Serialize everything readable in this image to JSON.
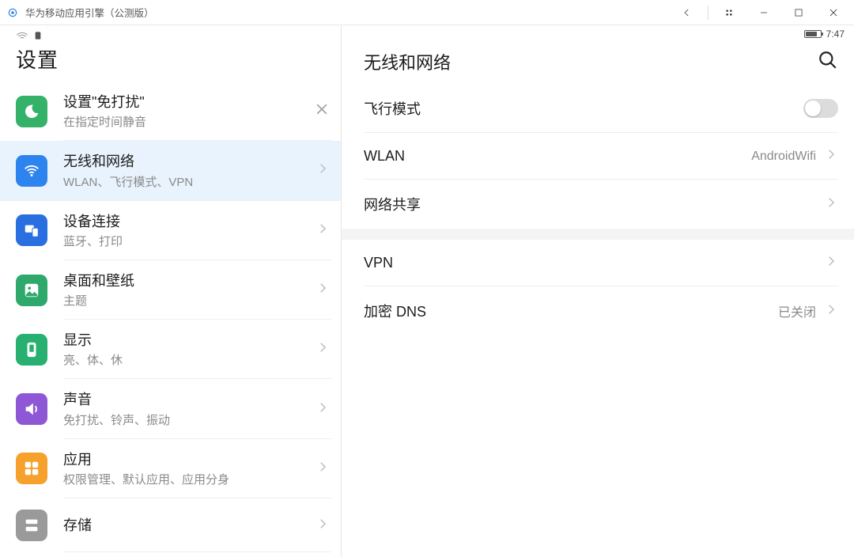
{
  "window": {
    "title": "华为移动应用引擎（公测版）"
  },
  "status": {
    "time": "7:47"
  },
  "left": {
    "title": "设置",
    "items": [
      {
        "icon": "moon",
        "bg": "bg-green",
        "label": "设置\"免打扰\"",
        "sub": "在指定时间静音",
        "trailing": "close"
      },
      {
        "icon": "wifi",
        "bg": "bg-blue",
        "label": "无线和网络",
        "sub": "WLAN、飞行模式、VPN",
        "trailing": "chev",
        "selected": true
      },
      {
        "icon": "devices",
        "bg": "bg-blue2",
        "label": "设备连接",
        "sub": "蓝牙、打印",
        "trailing": "chev"
      },
      {
        "icon": "wallpaper",
        "bg": "bg-green2",
        "label": "桌面和壁纸",
        "sub": "主题",
        "trailing": "chev"
      },
      {
        "icon": "display",
        "bg": "bg-teal",
        "label": "显示",
        "sub": "亮、体、休",
        "trailing": "chev"
      },
      {
        "icon": "sound",
        "bg": "bg-purple",
        "label": "声音",
        "sub": "免打扰、铃声、振动",
        "trailing": "chev"
      },
      {
        "icon": "apps",
        "bg": "bg-orange",
        "label": "应用",
        "sub": "权限管理、默认应用、应用分身",
        "trailing": "chev"
      },
      {
        "icon": "storage",
        "bg": "bg-grey",
        "label": "存储",
        "sub": "",
        "trailing": "chev"
      }
    ]
  },
  "right": {
    "title": "无线和网络",
    "groups": [
      {
        "rows": [
          {
            "key": "airplane",
            "label": "飞行模式",
            "type": "toggle",
            "on": false
          },
          {
            "key": "wlan",
            "label": "WLAN",
            "type": "link",
            "value": "AndroidWifi"
          },
          {
            "key": "tether",
            "label": "网络共享",
            "type": "link"
          }
        ]
      },
      {
        "rows": [
          {
            "key": "vpn",
            "label": "VPN",
            "type": "link"
          },
          {
            "key": "dns",
            "label": "加密 DNS",
            "type": "link",
            "value": "已关闭"
          }
        ]
      }
    ]
  }
}
